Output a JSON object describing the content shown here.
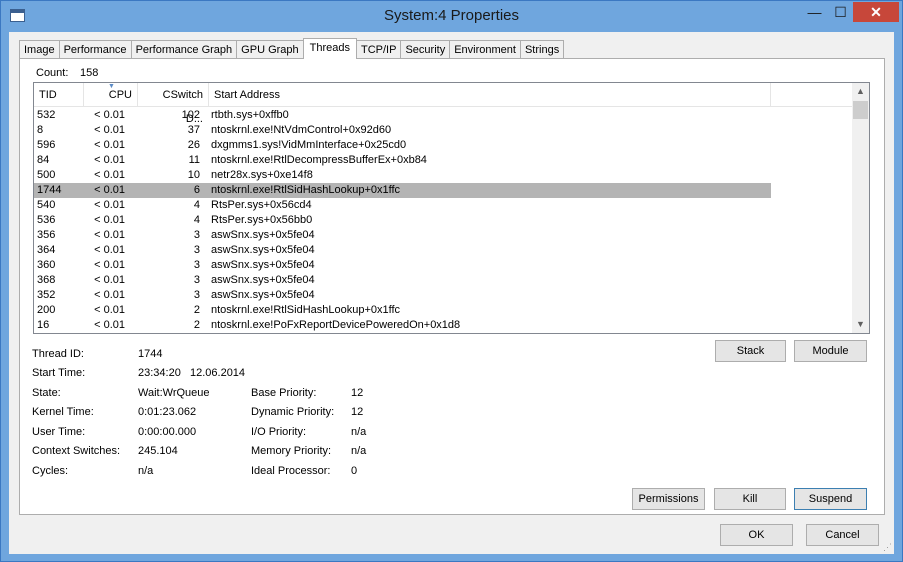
{
  "window": {
    "title": "System:4 Properties"
  },
  "title_buttons": {
    "minimize": "—",
    "maximize": "☐",
    "close": "✕"
  },
  "tabs": [
    {
      "label": "Image"
    },
    {
      "label": "Performance"
    },
    {
      "label": "Performance Graph"
    },
    {
      "label": "GPU Graph"
    },
    {
      "label": "Threads",
      "active": true
    },
    {
      "label": "TCP/IP"
    },
    {
      "label": "Security"
    },
    {
      "label": "Environment"
    },
    {
      "label": "Strings"
    }
  ],
  "threads": {
    "count_label": "Count:",
    "count_value": "158",
    "columns": {
      "tid": "TID",
      "cpu": "CPU",
      "cswitch": "CSwitch D...",
      "address": "Start Address"
    },
    "rows": [
      {
        "tid": "532",
        "cpu": "< 0.01",
        "cswitch": "102",
        "address": "rtbth.sys+0xffb0"
      },
      {
        "tid": "8",
        "cpu": "< 0.01",
        "cswitch": "37",
        "address": "ntoskrnl.exe!NtVdmControl+0x92d60"
      },
      {
        "tid": "596",
        "cpu": "< 0.01",
        "cswitch": "26",
        "address": "dxgmms1.sys!VidMmInterface+0x25cd0"
      },
      {
        "tid": "84",
        "cpu": "< 0.01",
        "cswitch": "11",
        "address": "ntoskrnl.exe!RtlDecompressBufferEx+0xb84"
      },
      {
        "tid": "500",
        "cpu": "< 0.01",
        "cswitch": "10",
        "address": "netr28x.sys+0xe14f8"
      },
      {
        "tid": "1744",
        "cpu": "< 0.01",
        "cswitch": "6",
        "address": "ntoskrnl.exe!RtlSidHashLookup+0x1ffc",
        "selected": true
      },
      {
        "tid": "540",
        "cpu": "< 0.01",
        "cswitch": "4",
        "address": "RtsPer.sys+0x56cd4"
      },
      {
        "tid": "536",
        "cpu": "< 0.01",
        "cswitch": "4",
        "address": "RtsPer.sys+0x56bb0"
      },
      {
        "tid": "356",
        "cpu": "< 0.01",
        "cswitch": "3",
        "address": "aswSnx.sys+0x5fe04"
      },
      {
        "tid": "364",
        "cpu": "< 0.01",
        "cswitch": "3",
        "address": "aswSnx.sys+0x5fe04"
      },
      {
        "tid": "360",
        "cpu": "< 0.01",
        "cswitch": "3",
        "address": "aswSnx.sys+0x5fe04"
      },
      {
        "tid": "368",
        "cpu": "< 0.01",
        "cswitch": "3",
        "address": "aswSnx.sys+0x5fe04"
      },
      {
        "tid": "352",
        "cpu": "< 0.01",
        "cswitch": "3",
        "address": "aswSnx.sys+0x5fe04"
      },
      {
        "tid": "200",
        "cpu": "< 0.01",
        "cswitch": "2",
        "address": "ntoskrnl.exe!RtlSidHashLookup+0x1ffc"
      },
      {
        "tid": "16",
        "cpu": "< 0.01",
        "cswitch": "2",
        "address": "ntoskrnl.exe!PoFxReportDevicePoweredOn+0x1d8"
      }
    ]
  },
  "details": {
    "thread_id_label": "Thread ID:",
    "thread_id": "1744",
    "start_time_label": "Start Time:",
    "start_time": "23:34:20   12.06.2014",
    "state_label": "State:",
    "state": "Wait:WrQueue",
    "kernel_time_label": "Kernel Time:",
    "kernel_time": "0:01:23.062",
    "user_time_label": "User Time:",
    "user_time": "0:00:00.000",
    "context_switches_label": "Context Switches:",
    "context_switches": "245.104",
    "cycles_label": "Cycles:",
    "cycles": "n/a",
    "base_priority_label": "Base Priority:",
    "base_priority": "12",
    "dynamic_priority_label": "Dynamic Priority:",
    "dynamic_priority": "12",
    "io_priority_label": "I/O Priority:",
    "io_priority": "n/a",
    "memory_priority_label": "Memory Priority:",
    "memory_priority": "n/a",
    "ideal_processor_label": "Ideal Processor:",
    "ideal_processor": "0"
  },
  "buttons": {
    "stack": "Stack",
    "module": "Module",
    "permissions": "Permissions",
    "kill": "Kill",
    "suspend": "Suspend",
    "ok": "OK",
    "cancel": "Cancel"
  }
}
